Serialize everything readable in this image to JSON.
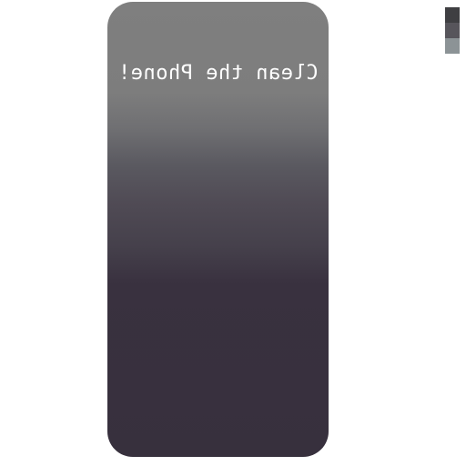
{
  "game": {
    "title": "Clean the Phone!"
  },
  "colors": {
    "background": "#ffffff",
    "screen_top": "#7f7f7f",
    "screen_mid": "#504b55",
    "screen_bottom": "#37303d",
    "title_text": "#ffffff"
  },
  "palette": {
    "swatches": [
      {
        "color": "#3f3f42"
      },
      {
        "color": "#57555b"
      },
      {
        "color": "#8c9396"
      }
    ]
  }
}
